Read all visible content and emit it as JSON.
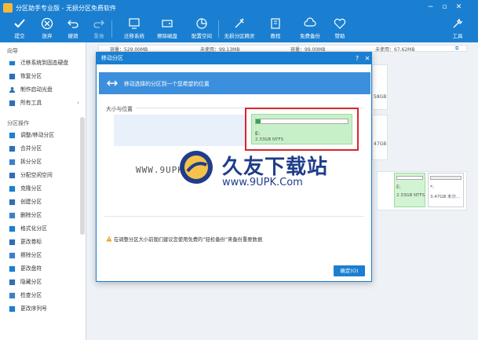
{
  "window": {
    "title": "分区助手专业版 - 无损分区免费软件",
    "controls": [
      "minimize-icon",
      "restore-icon",
      "close-icon"
    ]
  },
  "toolbar": {
    "items": [
      {
        "label": "提交",
        "icon": "check-icon",
        "enabled": true
      },
      {
        "label": "放弃",
        "icon": "discard-icon",
        "enabled": true
      },
      {
        "label": "撤销",
        "icon": "undo-icon",
        "enabled": true
      },
      {
        "label": "重做",
        "icon": "redo-icon",
        "enabled": false
      },
      {
        "label": "迁移系统",
        "icon": "migrate-icon",
        "enabled": true
      },
      {
        "label": "擦除磁盘",
        "icon": "wipe-icon",
        "enabled": true
      },
      {
        "label": "配置空间",
        "icon": "pie-icon",
        "enabled": true
      },
      {
        "label": "无损分区精灵",
        "icon": "wizard-icon",
        "enabled": true
      },
      {
        "label": "教程",
        "icon": "book-icon",
        "enabled": true
      },
      {
        "label": "免费备份",
        "icon": "backup-icon",
        "enabled": true
      },
      {
        "label": "赞助",
        "icon": "heart-icon",
        "enabled": true
      },
      {
        "label": "工具",
        "icon": "tools-icon",
        "enabled": true
      }
    ]
  },
  "sidebar": {
    "group1_title": "向导",
    "group1": [
      {
        "label": "迁移系统到固态硬盘",
        "icon": "disk-icon"
      },
      {
        "label": "恢复分区",
        "icon": "recover-icon"
      },
      {
        "label": "制作启动光盘",
        "icon": "user-icon"
      },
      {
        "label": "所有工具",
        "icon": "tools-icon",
        "has_arrow": true
      }
    ],
    "group2_title": "分区操作",
    "group2": [
      {
        "label": "调整/移动分区",
        "icon": "resize-icon"
      },
      {
        "label": "合并分区",
        "icon": "merge-icon"
      },
      {
        "label": "拆分分区",
        "icon": "split-icon"
      },
      {
        "label": "分配空闲空间",
        "icon": "allocate-icon"
      },
      {
        "label": "克隆分区",
        "icon": "clone-icon"
      },
      {
        "label": "创建分区",
        "icon": "create-icon"
      },
      {
        "label": "删除分区",
        "icon": "delete-icon"
      },
      {
        "label": "格式化分区",
        "icon": "format-icon"
      },
      {
        "label": "更改卷标",
        "icon": "label-icon"
      },
      {
        "label": "擦除分区",
        "icon": "erase-icon"
      },
      {
        "label": "更改盘符",
        "icon": "letter-icon"
      },
      {
        "label": "隐藏分区",
        "icon": "hide-icon"
      },
      {
        "label": "检查分区",
        "icon": "check-part-icon"
      },
      {
        "label": "更改序列号",
        "icon": "serial-icon"
      }
    ]
  },
  "background": {
    "cap1": "容量：529.00MB",
    "free1": "未使用：99.13MB",
    "cap2": "容量：99.00MB",
    "free2": "未使用：67.62MB",
    "gb1": "58GB",
    "gb2": "47GB",
    "disk_e_letter": "E:",
    "disk_e_size": "2.33GB NTFS",
    "disk_unalloc_letter": "*:",
    "disk_unalloc_size": "3.47GB 未分..."
  },
  "dialog": {
    "title": "移动分区",
    "help": "?",
    "close": "✕",
    "banner_text": "移动选择的分区到一个您希望的位置",
    "section_label": "大小与位置",
    "partition": {
      "letter": "E:",
      "size": "2.33GB NTFS",
      "used_fraction": 0.05
    },
    "warning": "在调整分区大小前我们建议您使用免费的“轻松备份”来备份重要数据",
    "ok_label": "确定(O)"
  },
  "watermark": {
    "url": "WWW.9UPK.COM",
    "cn": "久友下载站",
    "en": "www.9UPK.Com"
  },
  "colors": {
    "brand_blue": "#1a7fd1",
    "highlight_red": "#d8262b",
    "partition_green": "#c8f0c8"
  }
}
